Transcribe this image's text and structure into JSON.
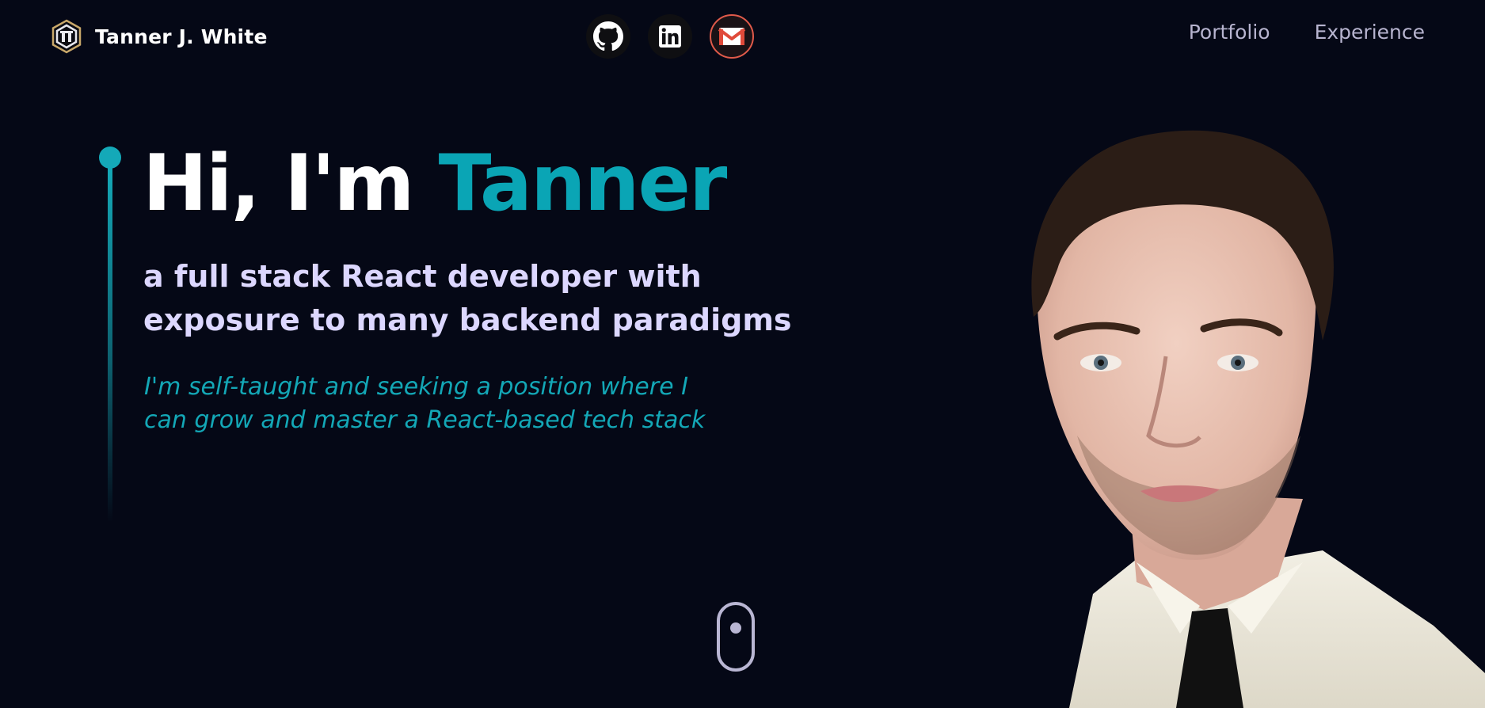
{
  "brand": {
    "name": "Tanner  J. White",
    "logo_icon": "hexagon-logo-icon"
  },
  "socials": [
    {
      "name": "github",
      "icon": "github-icon"
    },
    {
      "name": "linkedin",
      "icon": "linkedin-icon"
    },
    {
      "name": "email",
      "icon": "gmail-icon"
    }
  ],
  "nav": {
    "links": [
      "Portfolio",
      "Experience"
    ]
  },
  "hero": {
    "greeting": "Hi, I'm",
    "name": "Tanner",
    "subtitle_line1": "a full stack React developer with",
    "subtitle_line2": "exposure to many backend paradigms",
    "tagline_line1": "I'm self-taught and seeking a position where I",
    "tagline_line2": "can grow and master a React-based tech stack"
  },
  "scroll_indicator": {
    "icon": "mouse-scroll-icon"
  },
  "colors": {
    "background": "#050816",
    "accent": "#14a9b8",
    "heading": "#ffffff",
    "subtitle": "#dcd7ff",
    "nav_text": "#b7b4cf"
  }
}
